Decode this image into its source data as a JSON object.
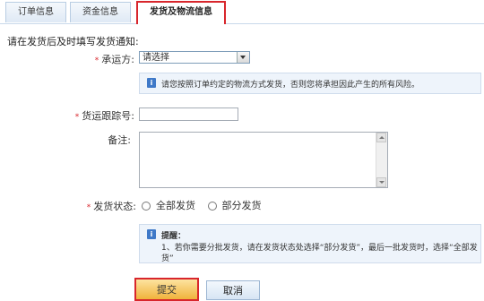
{
  "tabs": [
    {
      "label": "订单信息",
      "active": false
    },
    {
      "label": "资金信息",
      "active": false
    },
    {
      "label": "发货及物流信息",
      "active": true
    }
  ],
  "instruction": "请在发货后及时填写发货通知:",
  "form": {
    "carrier": {
      "label": "承运方:",
      "required": "*",
      "value": "请选择"
    },
    "carrier_hint": "请您按照订单约定的物流方式发货，否则您将承担因此产生的所有风险。",
    "tracking": {
      "label": "货运跟踪号:",
      "required": "*",
      "value": ""
    },
    "remark": {
      "label": "备注:",
      "value": ""
    },
    "ship_status": {
      "label": "发货状态:",
      "required": "*",
      "options": [
        "全部发货",
        "部分发货"
      ]
    },
    "tip_title": "提醒：",
    "tip_line1": "1、若你需要分批发货，请在发货状态处选择“部分发货”，最后一批发货时，选择“全部发",
    "tip_line2": "货”"
  },
  "buttons": {
    "submit": "提交",
    "cancel": "取消"
  },
  "colors": {
    "highlight": "#d8262c",
    "info_bg": "#eef4fb",
    "info_icon": "#3f79c8"
  }
}
